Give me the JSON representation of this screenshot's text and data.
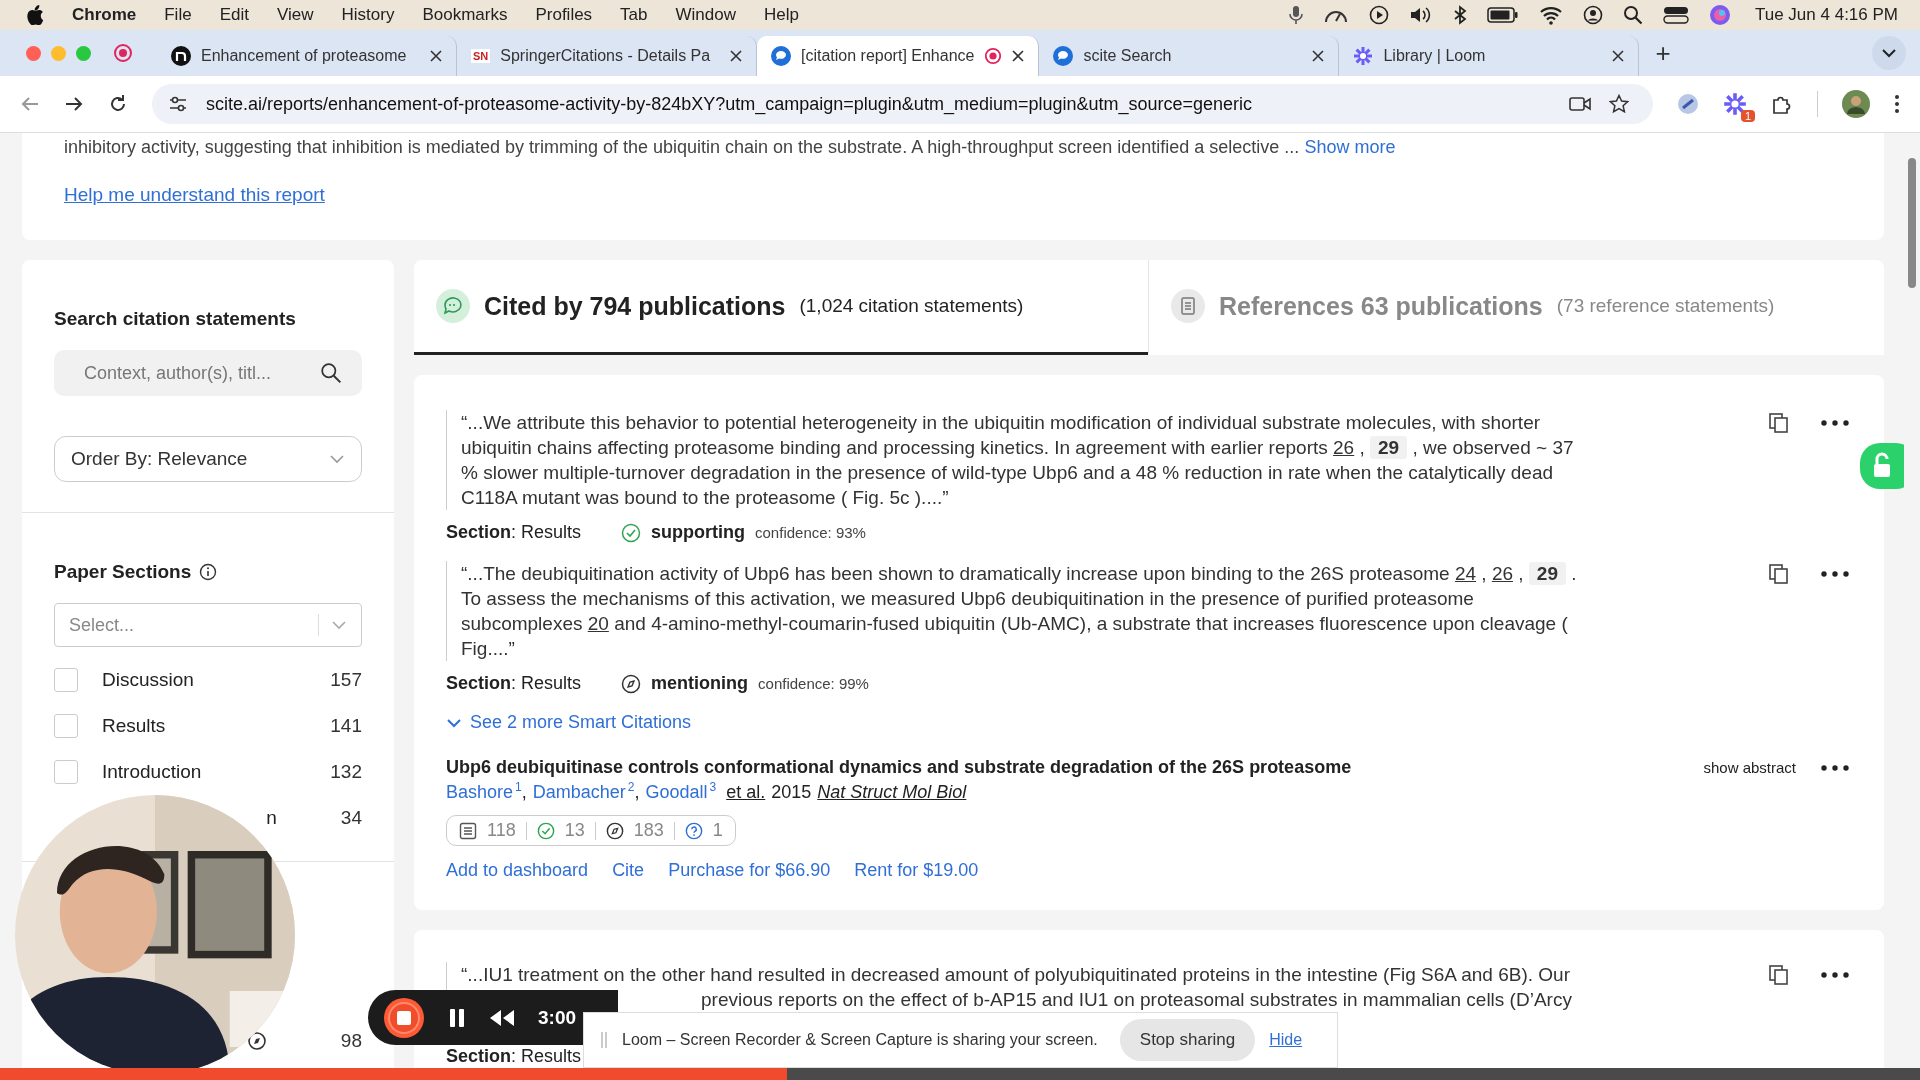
{
  "menubar": {
    "app": "Chrome",
    "items": [
      "File",
      "Edit",
      "View",
      "History",
      "Bookmarks",
      "Profiles",
      "Tab",
      "Window",
      "Help"
    ],
    "clock": "Tue Jun 4  4:16 PM"
  },
  "browser": {
    "tabs": [
      {
        "title": "Enhancement of proteasome",
        "kind": "ring",
        "selected": false,
        "recording": false
      },
      {
        "title": "SpringerCitations - Details Pa",
        "kind": "letters",
        "badge": "SN",
        "selected": false,
        "recording": false
      },
      {
        "title": "[citation report] Enhance",
        "kind": "scite",
        "selected": true,
        "recording": true
      },
      {
        "title": "scite Search",
        "kind": "scite",
        "selected": false,
        "recording": false
      },
      {
        "title": "Library | Loom",
        "kind": "loom",
        "selected": false,
        "recording": false
      }
    ],
    "new_tab": "+",
    "url": "scite.ai/reports/enhancement-of-proteasome-activity-by-824bXY?utm_campaign=plugin&utm_medium=plugin&utm_source=generic",
    "extension_badge": "1"
  },
  "report": {
    "abstract_tail": "inhibitory activity, suggesting that inhibition is mediated by trimming of the ubiquitin chain on the substrate. A high-throughput screen identified a selective ...",
    "show_more": "Show more",
    "help_link": "Help me understand this report"
  },
  "sidebar": {
    "search_heading": "Search citation statements",
    "search_placeholder": "Context, author(s), titl...",
    "order_by": "Order By: Relevance",
    "sections_heading": "Paper Sections",
    "select_placeholder": "Select...",
    "sections": [
      {
        "label": "Discussion",
        "count": "157",
        "checked": false
      },
      {
        "label": "Results",
        "count": "141",
        "checked": false
      },
      {
        "label": "Introduction",
        "count": "132",
        "checked": false
      },
      {
        "label": "n",
        "count": "34",
        "partial": true
      }
    ],
    "lower_row": {
      "count": "98"
    }
  },
  "main_tabs": [
    {
      "kind": "cited",
      "title": "Cited by 794 publications",
      "detail": "(1,024 citation statements)",
      "selected": true
    },
    {
      "kind": "references",
      "title": "References 63 publications",
      "detail": "(73 reference statements)",
      "selected": false
    }
  ],
  "results": [
    {
      "statements": [
        {
          "segments": [
            {
              "kind": "text",
              "text": "“...We attribute this behavior to potential heterogeneity in the ubiquitin modification of individual substrate molecules, with shorter ubiquitin chains affecting proteasome binding and processing kinetics. In agreement with earlier reports "
            },
            {
              "kind": "ref",
              "text": "26"
            },
            {
              "kind": "text",
              "text": " , "
            },
            {
              "kind": "current",
              "text": "29"
            },
            {
              "kind": "text",
              "text": " , we observed ~ 37 % slower multiple-turnover degradation in the presence of wild-type Ubp6 and a 48 % reduction in rate when the catalytically dead C118A mutant was bound to the proteasome ( Fig. 5c )....”"
            }
          ],
          "section": "**Section**: Results",
          "kind": "supporting",
          "label": "supporting",
          "confidence": "confidence: 93%"
        },
        {
          "segments": [
            {
              "kind": "text",
              "text": "“...The deubiquitination activity of Ubp6 has been shown to dramatically increase upon binding to the 26S proteasome "
            },
            {
              "kind": "ref",
              "text": "24"
            },
            {
              "kind": "text",
              "text": " , "
            },
            {
              "kind": "ref",
              "text": "26"
            },
            {
              "kind": "text",
              "text": " , "
            },
            {
              "kind": "current",
              "text": "29"
            },
            {
              "kind": "text",
              "text": " . To assess the mechanisms of this activation, we measured Ubp6 deubiquitination in the presence of purified proteasome subcomplexes "
            },
            {
              "kind": "ref",
              "text": "20"
            },
            {
              "kind": "text",
              "text": " and 4-amino-methyl-coumarin-fused ubiquitin (Ub-AMC), a substrate that increases fluorescence upon cleavage ( Fig....”"
            }
          ],
          "section": "**Section**: Results",
          "kind": "mentioning",
          "label": "mentioning",
          "confidence": "confidence: 99%"
        }
      ],
      "see_more": "See 2 more Smart Citations",
      "paper": {
        "title": "Ubp6 deubiquitinase controls conformational dynamics and substrate degradation of the 26S proteasome",
        "authors": [
          {
            "name": "Bashore",
            "sup": "1",
            "sep": ","
          },
          {
            "name": "Dambacher",
            "sup": "2",
            "sep": ","
          },
          {
            "name": "Goodall",
            "sup": "3"
          }
        ],
        "et_al": "et al.",
        "year": "2015",
        "journal": "Nat Struct Mol Biol",
        "show_abstract": "show abstract",
        "counts": [
          {
            "kind": "publications",
            "value": "118"
          },
          {
            "kind": "supporting",
            "value": "13"
          },
          {
            "kind": "mentioning",
            "value": "183"
          },
          {
            "kind": "unclassified",
            "value": "1"
          }
        ],
        "actions": [
          "Add to dashboard",
          "Cite",
          "Purchase for $66.90",
          "Rent for $19.00"
        ]
      }
    }
  ],
  "next_result": {
    "line_1": "“...IU1 treatment on the other hand resulted in decreased amount of polyubiquitinated proteins in the intestine (Fig S6A and 6B). Our",
    "line_2": "previous reports on the effect of b-AP15 and IU1 on proteasomal substrates in mammalian cells (D’Arcy",
    "section": "**Section**: Results"
  },
  "loom": {
    "time": "3:00",
    "sharing_text": "Loom – Screen Recorder & Screen Capture is sharing your screen.",
    "stop_sharing": "Stop sharing",
    "hide": "Hide",
    "progress": {
      "level": 0.41
    }
  }
}
